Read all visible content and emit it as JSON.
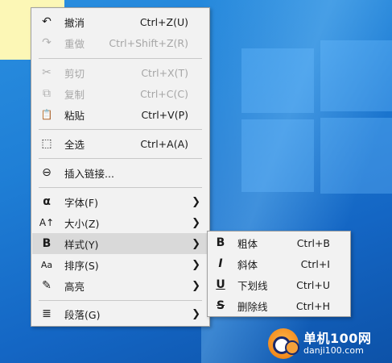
{
  "main_menu": {
    "items": [
      {
        "icon": "undo-icon",
        "label": "撤消",
        "shortcut": "Ctrl+Z(U)"
      },
      {
        "icon": "redo-icon",
        "label": "重做",
        "shortcut": "Ctrl+Shift+Z(R)"
      },
      {
        "icon": "cut-icon",
        "label": "剪切",
        "shortcut": "Ctrl+X(T)"
      },
      {
        "icon": "copy-icon",
        "label": "复制",
        "shortcut": "Ctrl+C(C)"
      },
      {
        "icon": "paste-icon",
        "label": "粘贴",
        "shortcut": "Ctrl+V(P)"
      },
      {
        "icon": "select-all-icon",
        "label": "全选",
        "shortcut": "Ctrl+A(A)"
      },
      {
        "icon": "link-icon",
        "label": "插入链接..."
      },
      {
        "icon": "font-icon",
        "label": "字体(F)"
      },
      {
        "icon": "font-size-icon",
        "label": "大小(Z)"
      },
      {
        "icon": "bold-icon",
        "label": "样式(Y)"
      },
      {
        "icon": "sort-icon",
        "label": "排序(S)"
      },
      {
        "icon": "highlight-icon",
        "label": "高亮"
      },
      {
        "icon": "paragraph-icon",
        "label": "段落(G)"
      }
    ]
  },
  "sub_menu": {
    "items": [
      {
        "icon": "bold-icon",
        "label": "粗体",
        "shortcut": "Ctrl+B"
      },
      {
        "icon": "italic-icon",
        "label": "斜体",
        "shortcut": "Ctrl+I"
      },
      {
        "icon": "underline-icon",
        "label": "下划线",
        "shortcut": "Ctrl+U"
      },
      {
        "icon": "strikethrough-icon",
        "label": "删除线",
        "shortcut": "Ctrl+H"
      }
    ]
  },
  "glyphs": {
    "undo": "↶",
    "redo": "↷",
    "cut": "✂",
    "copy": "⧉",
    "paste": "📋",
    "select_all": "⬚",
    "link": "⊖",
    "font": "α",
    "font_size": "A↑",
    "bold": "B",
    "sort": "Aa",
    "highlight": "✎",
    "paragraph": "≣",
    "italic": "I",
    "underline": "U",
    "strike": "S",
    "submenu_arrow": "❯"
  },
  "watermark": {
    "name": "单机100网",
    "url": "danji100.com"
  },
  "colors": {
    "menu_bg": "#f2f2f2",
    "highlight": "#d9d9d9",
    "disabled": "#a6a6a6",
    "desktop": "#1f7fd6",
    "note": "#fcf7b6"
  }
}
